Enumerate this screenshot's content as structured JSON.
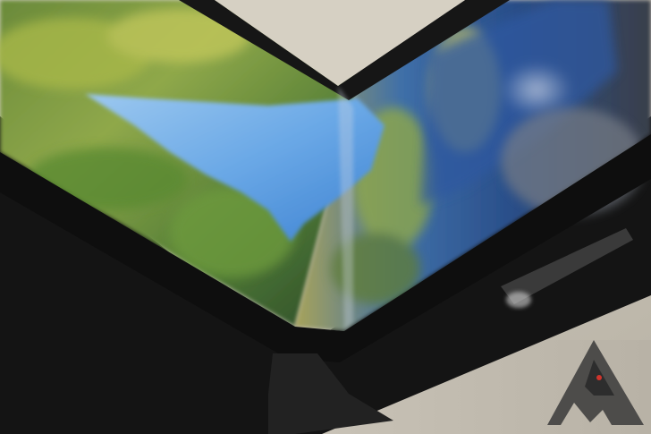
{
  "photo": {
    "subject": "",
    "watermark": {
      "icon": "android-police-logo-icon",
      "brand_color": "#3a3a3a",
      "accent_color": "#d0342c"
    }
  }
}
